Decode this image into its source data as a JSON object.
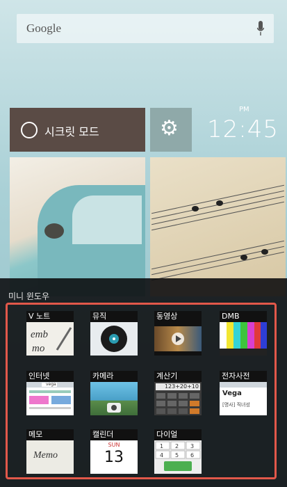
{
  "search": {
    "label": "Google",
    "mic_icon": "microphone-icon"
  },
  "tiles": {
    "secret_mode": "시크릿 모드",
    "settings_icon": "gear-icon"
  },
  "clock": {
    "ampm": "PM",
    "time": "12:45"
  },
  "mini_window": {
    "title": "미니 윈도우",
    "items": [
      {
        "label": "V 노트",
        "icon": "note-icon"
      },
      {
        "label": "뮤직",
        "icon": "music-disc-icon"
      },
      {
        "label": "동영상",
        "icon": "video-play-icon"
      },
      {
        "label": "DMB",
        "icon": "tv-bars-icon"
      },
      {
        "label": "인터넷",
        "icon": "browser-icon",
        "text": "vega"
      },
      {
        "label": "카메라",
        "icon": "camera-icon"
      },
      {
        "label": "계산기",
        "icon": "calculator-icon",
        "text": "123+20+10"
      },
      {
        "label": "전자사전",
        "icon": "dictionary-icon",
        "text": "Vega",
        "text2": "[명사] 직녀성"
      },
      {
        "label": "메모",
        "icon": "memo-icon",
        "text": "Memo"
      },
      {
        "label": "캘린더",
        "icon": "calendar-icon",
        "day": "SUN",
        "date": "13"
      },
      {
        "label": "다이얼",
        "icon": "dialpad-icon"
      }
    ]
  }
}
